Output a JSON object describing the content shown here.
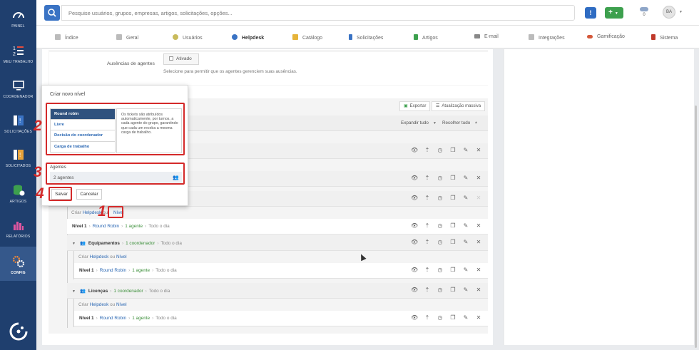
{
  "sidebar": {
    "items": [
      {
        "label": "PAINEL",
        "icon": "dashboard-icon"
      },
      {
        "label": "MEU TRABALHO",
        "icon": "task-list-icon"
      },
      {
        "label": "COORDENADOR",
        "icon": "monitor-icon"
      },
      {
        "label": "SOLICITAÇÕES",
        "icon": "requests-icon"
      },
      {
        "label": "SOLICITADOS",
        "icon": "requested-icon"
      },
      {
        "label": "ARTIGOS",
        "icon": "database-icon"
      },
      {
        "label": "RELATÓRIOS",
        "icon": "bar-chart-icon"
      },
      {
        "label": "CONFIG",
        "icon": "gears-icon"
      }
    ]
  },
  "topbar": {
    "search_placeholder": "Pesquise usuários, grupos, empresas, artigos, solicitações, opções...",
    "info_label": "!",
    "add_label": "+",
    "counter": "0",
    "avatar": "BA"
  },
  "tabs": [
    {
      "label": "Índice",
      "color": "#9e9e9e"
    },
    {
      "label": "Geral",
      "color": "#9e9e9e"
    },
    {
      "label": "Usuários",
      "color": "#b5a642"
    },
    {
      "label": "Helpdesk",
      "color": "#3a73c4"
    },
    {
      "label": "Catálogo",
      "color": "#e6b43a"
    },
    {
      "label": "Solicitações",
      "color": "#3a73c4"
    },
    {
      "label": "Artigos",
      "color": "#3da04e"
    },
    {
      "label": "E-mail",
      "color": "#777777"
    },
    {
      "label": "Integrações",
      "color": "#9e9e9e"
    },
    {
      "label": "Gamificação",
      "color": "#d4583a"
    },
    {
      "label": "Sistema",
      "color": "#c0392b"
    }
  ],
  "absence": {
    "label": "Ausências de agentes",
    "checkbox_label": "Ativado",
    "help": "Selecione para permitir que os agentes gerenciem suas ausências."
  },
  "toolbar": {
    "export": "Exportar",
    "mass_update": "Atualização massiva",
    "expand_all": "Expandir tudo",
    "collapse_all": "Recolher tudo"
  },
  "tree": {
    "create_label": "Criar",
    "helpdesk": "Helpdesk",
    "or": "ou",
    "level": "Nível",
    "rows": [
      {
        "level": "Nível 1",
        "method": "Round Robin",
        "agents": "1 agente",
        "time": "Todo o dia"
      },
      {
        "group": "Equipamentos",
        "coord": "1 coordenador",
        "time": "Todo o dia"
      },
      {
        "level": "Nível 1",
        "method": "Round Robin",
        "agents": "1 agente",
        "time": "Todo o dia"
      },
      {
        "group": "Licenças",
        "coord": "1 coordenador",
        "time": "Todo o dia"
      },
      {
        "level": "Nível 1",
        "method": "Round Robin",
        "agents": "1 agente",
        "time": "Todo o dia"
      }
    ]
  },
  "modal": {
    "title": "Criar novo nível",
    "options": [
      "Round robin",
      "Livre",
      "Decisão do coordenador",
      "Carga de trabalho"
    ],
    "description": "Os tickets são atribuídos automaticamente, por turnos, a cada agente do grupo, garantindo que cada um receba a mesma carga de trabalho.",
    "agents_label": "Agentes",
    "agents_value": "2 agentes",
    "save": "Salvar",
    "cancel": "Cancelar"
  },
  "annotations": [
    "1",
    "2",
    "3",
    "4"
  ]
}
